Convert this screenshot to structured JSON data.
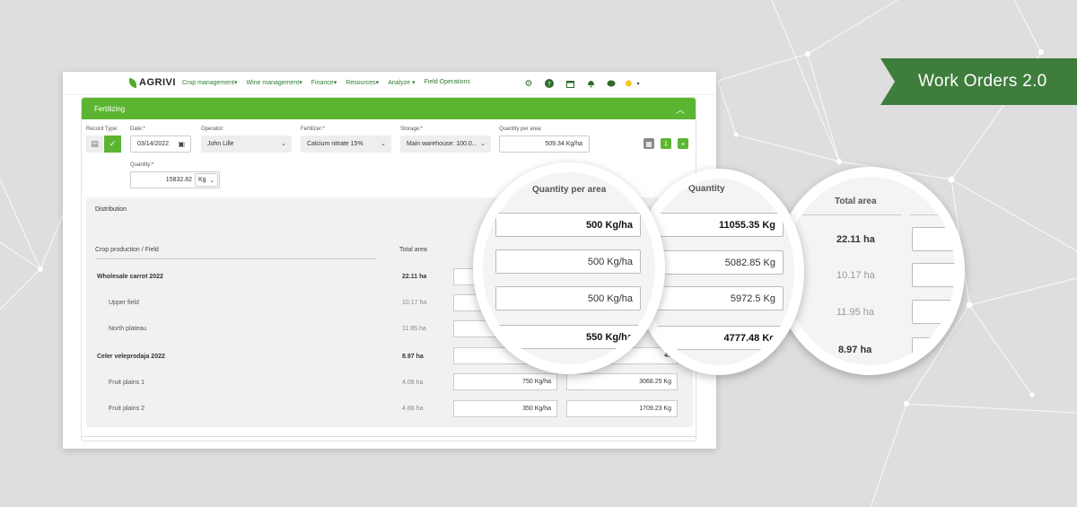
{
  "banner": {
    "title": "Work Orders 2.0"
  },
  "topnav": {
    "logo": "AGRIVI",
    "items": [
      "Crop management",
      "Wine management",
      "Finance",
      "Resources",
      "Analyze",
      "Field Operations"
    ],
    "icons": [
      "gear-icon",
      "help-icon",
      "calendar-icon",
      "bell-icon",
      "chat-icon",
      "user-avatar"
    ]
  },
  "panel": {
    "title": "Fertilizing",
    "record_type_label": "Record Type:",
    "date_label": "Date:*",
    "date_value": "03/14/2022",
    "operator_label": "Operator:",
    "operator_value": "John Lille",
    "fertilizer_label": "Fertilizer:*",
    "fertilizer_value": "Calcium nitrate 15%",
    "storage_label": "Storage:*",
    "storage_value": "Main warehouse: 100.0...",
    "qpa_label": "Quantity per area:",
    "qpa_value": "509.34 Kg/ha",
    "quantity_label": "Quantity:*",
    "quantity_value": "15832.82",
    "quantity_unit": "Kg"
  },
  "distribution": {
    "title": "Distribution",
    "col_crop": "Crop production / Field",
    "col_area": "Total area",
    "rows": [
      {
        "label": "Wholesale carrot 2022",
        "area": "22.11 ha",
        "qpa": "",
        "qty": ""
      },
      {
        "label": "Upper field",
        "area": "10.17 ha",
        "qpa": "",
        "qty": ""
      },
      {
        "label": "North plateau",
        "area": "11.95 ha",
        "qpa": "",
        "qty": ""
      },
      {
        "label": "Celer veleprodaja 2022",
        "area": "8.97 ha",
        "qpa": "",
        "qty": "47"
      },
      {
        "label": "Fruit plains 1",
        "area": "4.09 ha",
        "qpa": "750 Kg/ha",
        "qty": "3068.25 Kg"
      },
      {
        "label": "Fruit plains 2",
        "area": "4.88 ha",
        "qpa": "350 Kg/ha",
        "qty": "1709.23 Kg"
      }
    ]
  },
  "magnifier_qpa": {
    "header": "Quantity per area",
    "values": [
      "500 Kg/ha",
      "500 Kg/ha",
      "500 Kg/ha",
      "550 Kg/ha"
    ]
  },
  "magnifier_qty": {
    "header": "Quantity",
    "values": [
      "11055.35 Kg",
      "5082.85 Kg",
      "5972.5 Kg",
      "4777.48 Kg"
    ]
  },
  "magnifier_area": {
    "header": "Total area",
    "values": [
      "22.11 ha",
      "10.17 ha",
      "11.95 ha",
      "8.97 ha"
    ]
  },
  "colors": {
    "green": "#5cb531",
    "dark_green": "#3f7d3c",
    "background": "#dedede"
  }
}
